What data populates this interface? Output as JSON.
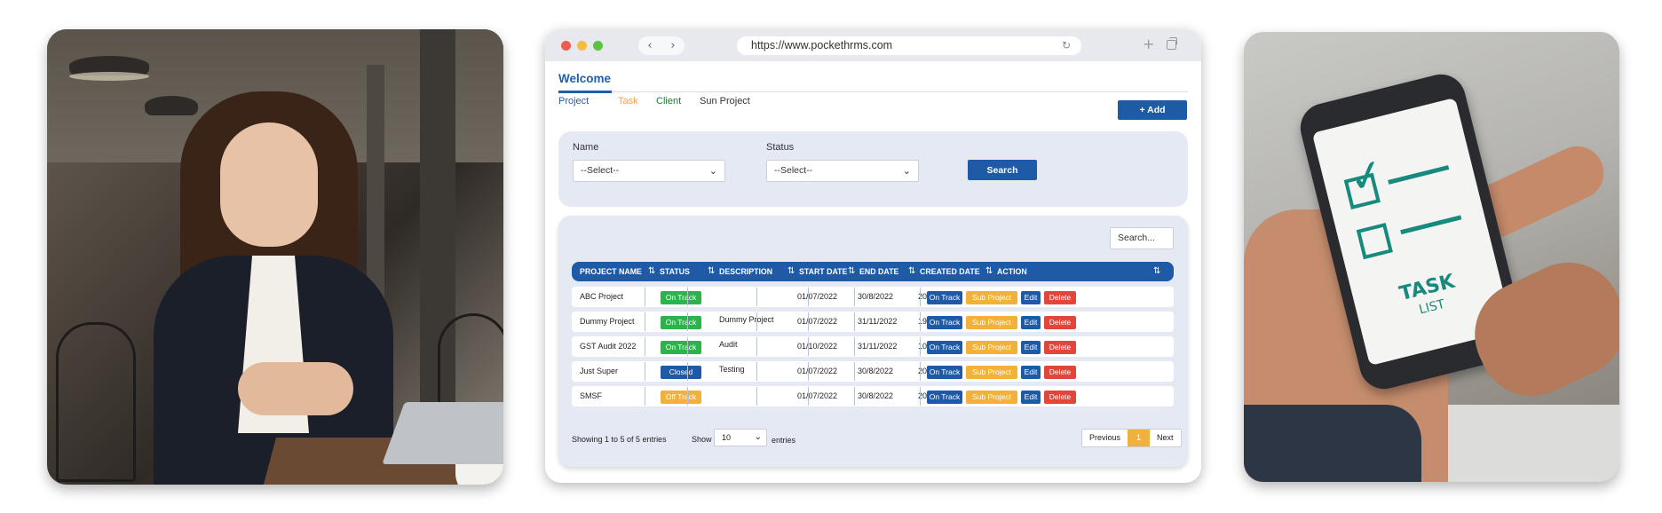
{
  "browser": {
    "url": "https://www.pockethrms.com",
    "nav_back": "‹",
    "nav_forward": "›",
    "reload_icon": "↻",
    "new_tab_icon": "+",
    "traffic_lights": [
      "#ee5b4f",
      "#f5bd3f",
      "#5dc244"
    ]
  },
  "page": {
    "title": "Welcome",
    "tabs": [
      {
        "label": "Project",
        "color": "#1f5faa"
      },
      {
        "label": "Task",
        "color": "#f0a63a"
      },
      {
        "label": "Client",
        "color": "#1a7a3a"
      },
      {
        "label": "Sun Project",
        "color": "#333333"
      }
    ],
    "add_label": "+  Add"
  },
  "filters": {
    "name_label": "Name",
    "name_value": "--Select--",
    "status_label": "Status",
    "status_value": "--Select--",
    "search_label": "Search"
  },
  "table": {
    "search_placeholder": "Search...",
    "columns": [
      "PROJECT NAME",
      "STATUS",
      "DESCRIPTION",
      "START DATE",
      "END DATE",
      "CREATED DATE",
      "ACTION"
    ],
    "rows": [
      {
        "name": "ABC Project",
        "status": "On Track",
        "status_color": "#2cb34a",
        "description": "",
        "start": "01/07/2022",
        "end": "30/8/2022",
        "created": "20/07/2022"
      },
      {
        "name": "Dummy Project",
        "status": "On Track",
        "status_color": "#2cb34a",
        "description": "Dummy Project",
        "start": "01/07/2022",
        "end": "31/11/2022",
        "created": "19/07/2022"
      },
      {
        "name": "GST Audit 2022",
        "status": "On Track",
        "status_color": "#2cb34a",
        "description": "Audit",
        "start": "01/10/2022",
        "end": "31/11/2022",
        "created": "10/10/2022"
      },
      {
        "name": "Just Super",
        "status": "Closed",
        "status_color": "#1f5aa6",
        "description": "Testing",
        "start": "01/07/2022",
        "end": "30/8/2022",
        "created": "20/07/2022"
      },
      {
        "name": "SMSF",
        "status": "Off Track",
        "status_color": "#f2b13a",
        "description": "",
        "start": "01/07/2022",
        "end": "30/8/2022",
        "created": "20/07/2022"
      }
    ],
    "actions": [
      {
        "label": "On Track",
        "color": "#1f5aa6"
      },
      {
        "label": "Sub Project",
        "color": "#f2b13a"
      },
      {
        "label": "Edit",
        "color": "#1f5aa6"
      },
      {
        "label": "Delete",
        "color": "#e2453a"
      }
    ]
  },
  "footer": {
    "showing": "Showing 1 to 5 of 5 entries",
    "show_label": "Show",
    "page_length": "10",
    "entries_label": "entries",
    "prev": "Previous",
    "current_page": "1",
    "next": "Next"
  },
  "photo_right": {
    "task_line1": "TASK",
    "task_line2": "LIST"
  }
}
